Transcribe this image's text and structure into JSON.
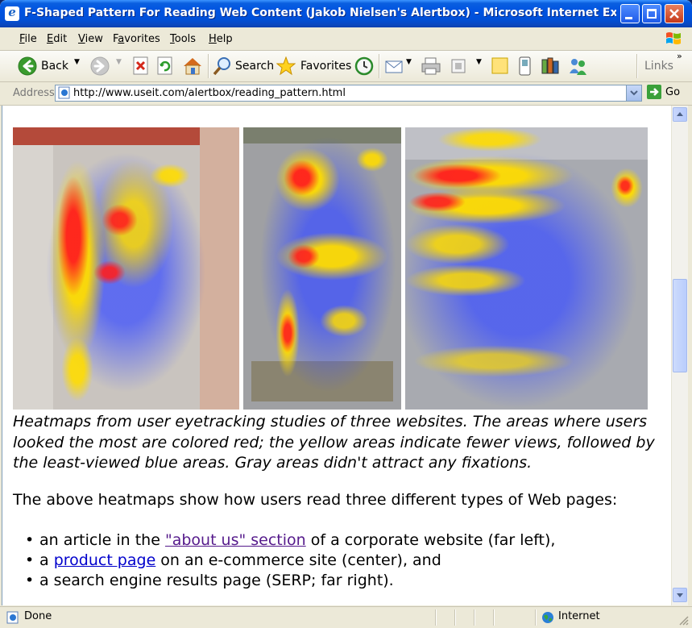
{
  "window": {
    "title": "F-Shaped Pattern For Reading Web Content (Jakob Nielsen's Alertbox) - Microsoft Internet Expl..."
  },
  "menu": [
    "File",
    "Edit",
    "View",
    "Favorites",
    "Tools",
    "Help"
  ],
  "menu_access_keys": [
    "F",
    "E",
    "V",
    "a",
    "T",
    "H"
  ],
  "toolbar": {
    "back_label": "Back",
    "search_label": "Search",
    "favorites_label": "Favorites",
    "links_label": "Links"
  },
  "address": {
    "label": "Address",
    "url": "http://www.useit.com/alertbox/reading_pattern.html",
    "go_label": "Go"
  },
  "content": {
    "caption": "Heatmaps from user eyetracking studies of three websites. The areas where users looked the most are colored red; the yellow areas indicate fewer views, followed by the least-viewed blue areas. Gray areas didn't attract any fixations.",
    "intro": "The above heatmaps show how users read three different types of Web pages:",
    "bullets": [
      {
        "pre": "an article in the ",
        "link": "\"about us\" section",
        "post": " of a corporate website (far left),"
      },
      {
        "pre": "a ",
        "link": "product page",
        "post": " on an e-commerce site (center), and"
      },
      {
        "pre": "a search engine results page (SERP; far right).",
        "link": "",
        "post": ""
      }
    ]
  },
  "status": {
    "text": "Done",
    "zone": "Internet"
  },
  "colors": {
    "titlebar": "#0050d8",
    "link": "#0000cc",
    "visited_link": "#551a8b",
    "heat_red": "#ff2020",
    "heat_yellow": "#ffe600",
    "heat_blue": "#3040ff"
  }
}
